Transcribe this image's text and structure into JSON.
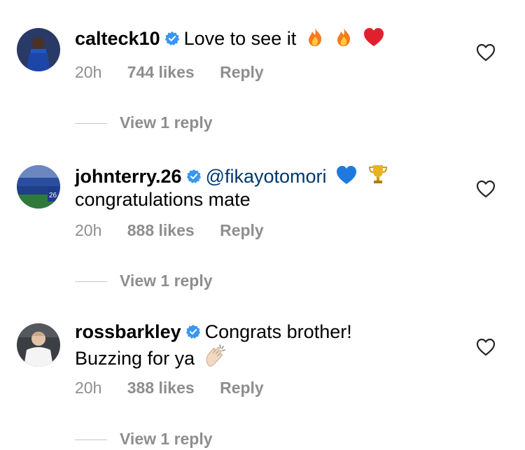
{
  "comments": [
    {
      "username": "calteck10",
      "text": "Love to see it",
      "mention": "",
      "text2": "",
      "age": "20h",
      "likes": "744 likes",
      "reply": "Reply",
      "view_replies": "View 1 reply",
      "emojis": [
        "fire-emoji",
        "fire-emoji",
        "red-heart-emoji"
      ]
    },
    {
      "username": "johnterry.26",
      "mention": "@fikayotomori",
      "text": "",
      "text2": "congratulations mate",
      "age": "20h",
      "likes": "888 likes",
      "reply": "Reply",
      "view_replies": "View 1 reply",
      "emojis": [
        "blue-heart-emoji",
        "trophy-emoji"
      ]
    },
    {
      "username": "rossbarkley",
      "text": "Congrats brother!",
      "mention": "",
      "text2": "Buzzing for ya",
      "age": "20h",
      "likes": "388 likes",
      "reply": "Reply",
      "view_replies": "View 1 reply",
      "emojis": [
        "clapping-hands-emoji"
      ]
    }
  ],
  "colors": {
    "verified": "#3897f0",
    "meta_gray": "#8e8e8e",
    "mention": "#00376b"
  }
}
